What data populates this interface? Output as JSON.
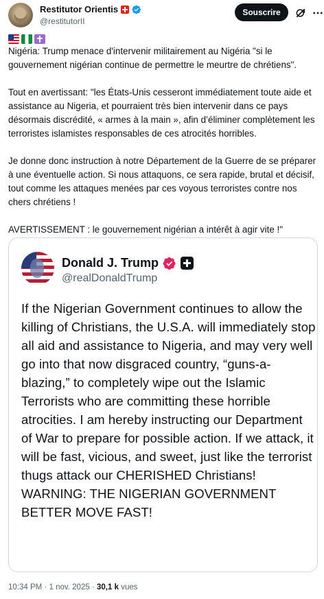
{
  "author": {
    "display_name": "Restitutor Orientis",
    "handle": "@restitutorII",
    "subscribe_label": "Souscrire"
  },
  "tweet": {
    "paragraphs": [
      "Nigéria: Trump menace d'intervenir militairement au Nigéria \"si le gouvernement nigérian continue de permettre le meurtre de chrétiens\".",
      "Tout en avertissant: \"les États-Unis cesseront immédiatement toute aide et assistance au Nigeria, et pourraient très bien intervenir dans ce pays désormais discrédité, « armes à la main », afin d’éliminer complètement les terroristes islamistes responsables de ces atrocités horribles.",
      "Je donne donc instruction à notre Département de la Guerre de se préparer à une éventuelle action. Si nous attaquons, ce sera rapide, brutal et décisif, tout comme les attaques menées par ces voyous terroristes contre nos chers chrétiens !",
      "AVERTISSEMENT : le gouvernement nigérian a intérêt à agir vite !\""
    ]
  },
  "quoted": {
    "display_name": "Donald J. Trump",
    "handle": "@realDonaldTrump",
    "text": "If the Nigerian Government continues to allow the killing of Christians, the U.S.A. will immediately stop all aid and assistance to Nigeria, and may very well go into that now disgraced country, “guns-a-blazing,” to completely wipe out the Islamic Terrorists who are committing these horrible atrocities. I am hereby instructing our Department of War to prepare for possible action. If we attack, it will be fast, vicious, and sweet, just like the terrorist thugs attack our CHERISHED Christians! WARNING: THE NIGERIAN GOVERNMENT BETTER MOVE FAST!"
  },
  "meta": {
    "time": "10:34 PM",
    "separator": "·",
    "date": "1 nov. 2025",
    "views_count": "30,1 k",
    "views_label": "vues"
  },
  "icons": {
    "verified": "verified-badge-icon",
    "grok": "grok-icon",
    "more": "more-icon",
    "flag_ch": "swiss-flag-icon",
    "flag_us": "us-flag-icon",
    "flag_ng": "nigeria-flag-icon",
    "latin_cross": "latin-cross-icon",
    "gold_badge": "gold-badge-icon",
    "plus": "premium-plus-icon"
  },
  "colors": {
    "accent_blue": "#1d9bf0",
    "text_primary": "#0f1419",
    "text_secondary": "#536471",
    "border": "#cfd9de",
    "gold_badge": "#e0245e"
  }
}
